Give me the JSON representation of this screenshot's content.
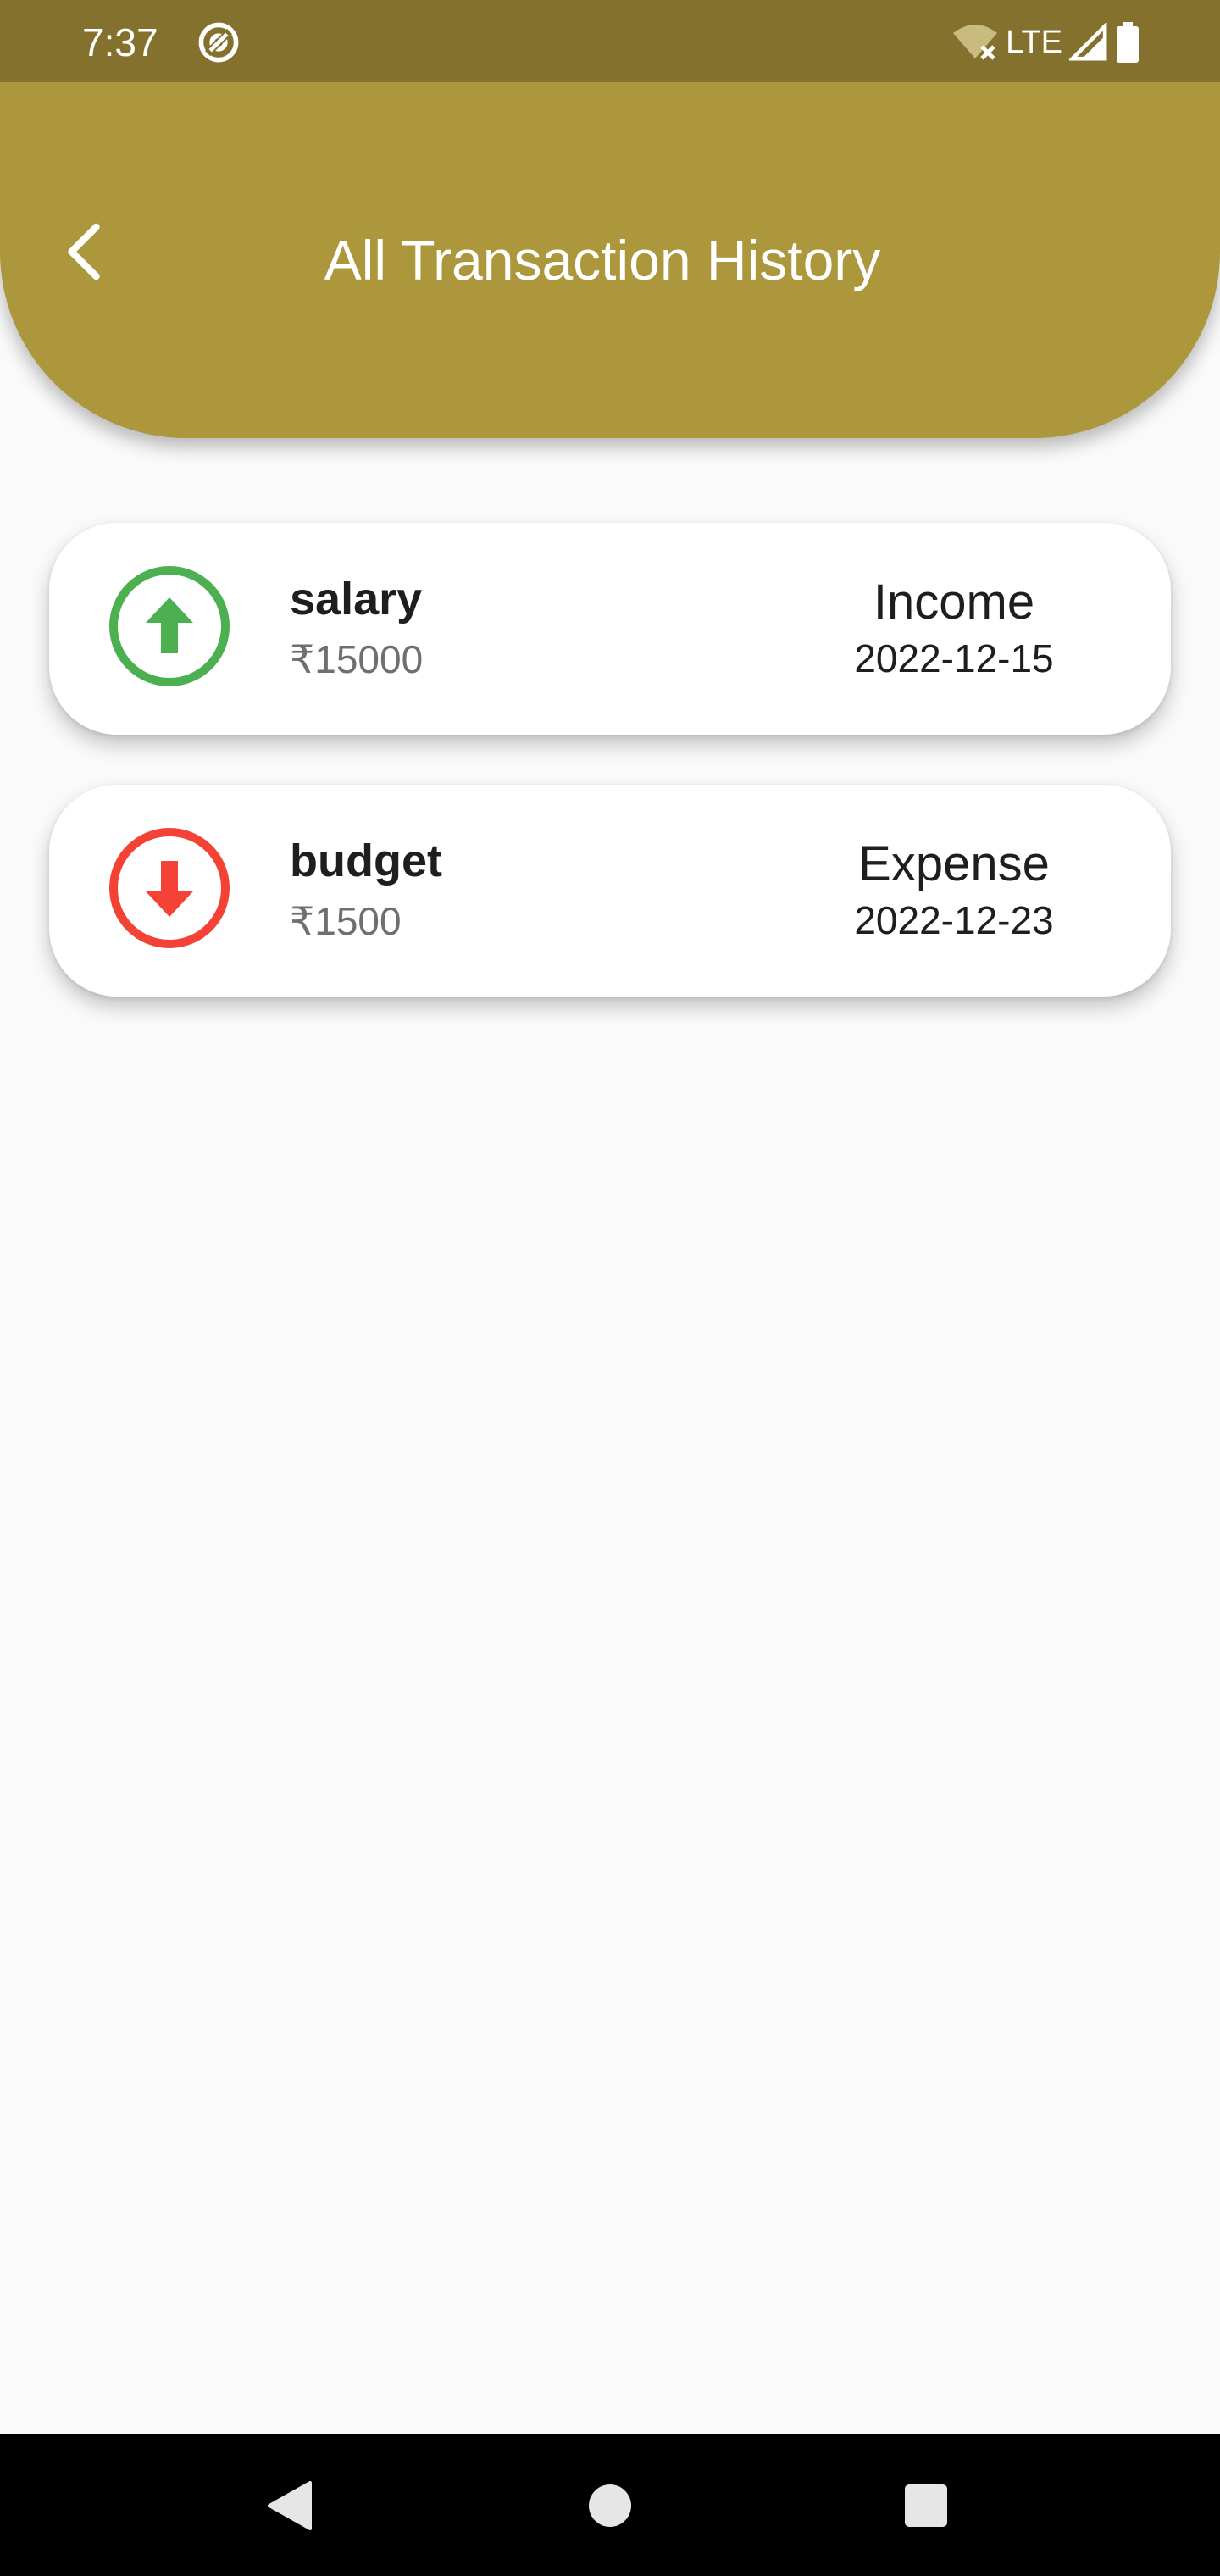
{
  "status_bar": {
    "time": "7:37",
    "network_label": "LTE",
    "icons": [
      "at-sign-icon",
      "wifi-off-icon",
      "signal-icon",
      "battery-icon"
    ]
  },
  "header": {
    "title": "All Transaction History",
    "back_icon": "chevron-left-icon",
    "color": "#ad973c"
  },
  "transactions": [
    {
      "title": "salary",
      "amount": "₹15000",
      "type": "Income",
      "date": "2022-12-15",
      "icon": "arrow-up-circle-icon",
      "color": "#4caf50"
    },
    {
      "title": "budget",
      "amount": "₹1500",
      "type": "Expense",
      "date": "2022-12-23",
      "icon": "arrow-down-circle-icon",
      "color": "#f44336"
    }
  ],
  "nav_bar": {
    "icons": [
      "back-triangle-icon",
      "home-circle-icon",
      "recents-square-icon"
    ]
  },
  "colors": {
    "status_bar": "#83712d",
    "background": "#fafafa",
    "income": "#4caf50",
    "expense": "#f44336"
  }
}
